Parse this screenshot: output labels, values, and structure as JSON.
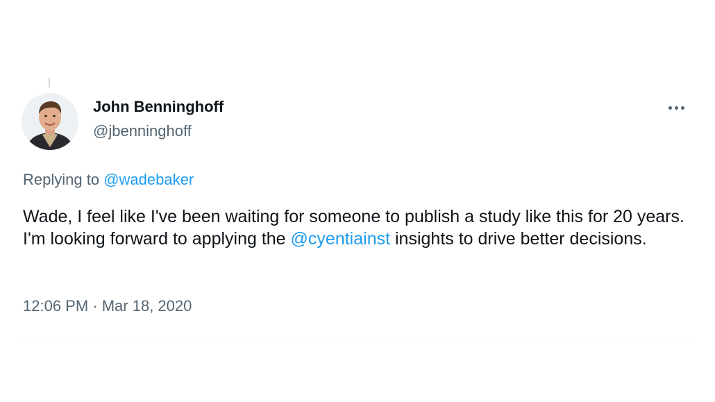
{
  "author": {
    "name": "John Benninghoff",
    "handle": "@jbenninghoff",
    "avatar_icon": "profile-photo"
  },
  "reply": {
    "prefix": "Replying to ",
    "mention": "@wadebaker"
  },
  "tweet": {
    "text_part1": "Wade, I feel like I've been waiting for someone to publish a study like this for 20 years. I'm looking forward to applying the ",
    "mention": "@cyentiainst",
    "text_part2": " insights to drive better decisions."
  },
  "meta": {
    "timestamp": "12:06 PM · Mar 18, 2020"
  },
  "colors": {
    "link": "#1d9bf0",
    "secondary_text": "#536471",
    "primary_text": "#0f1419"
  },
  "icons": {
    "more": "more-horizontal-icon"
  }
}
